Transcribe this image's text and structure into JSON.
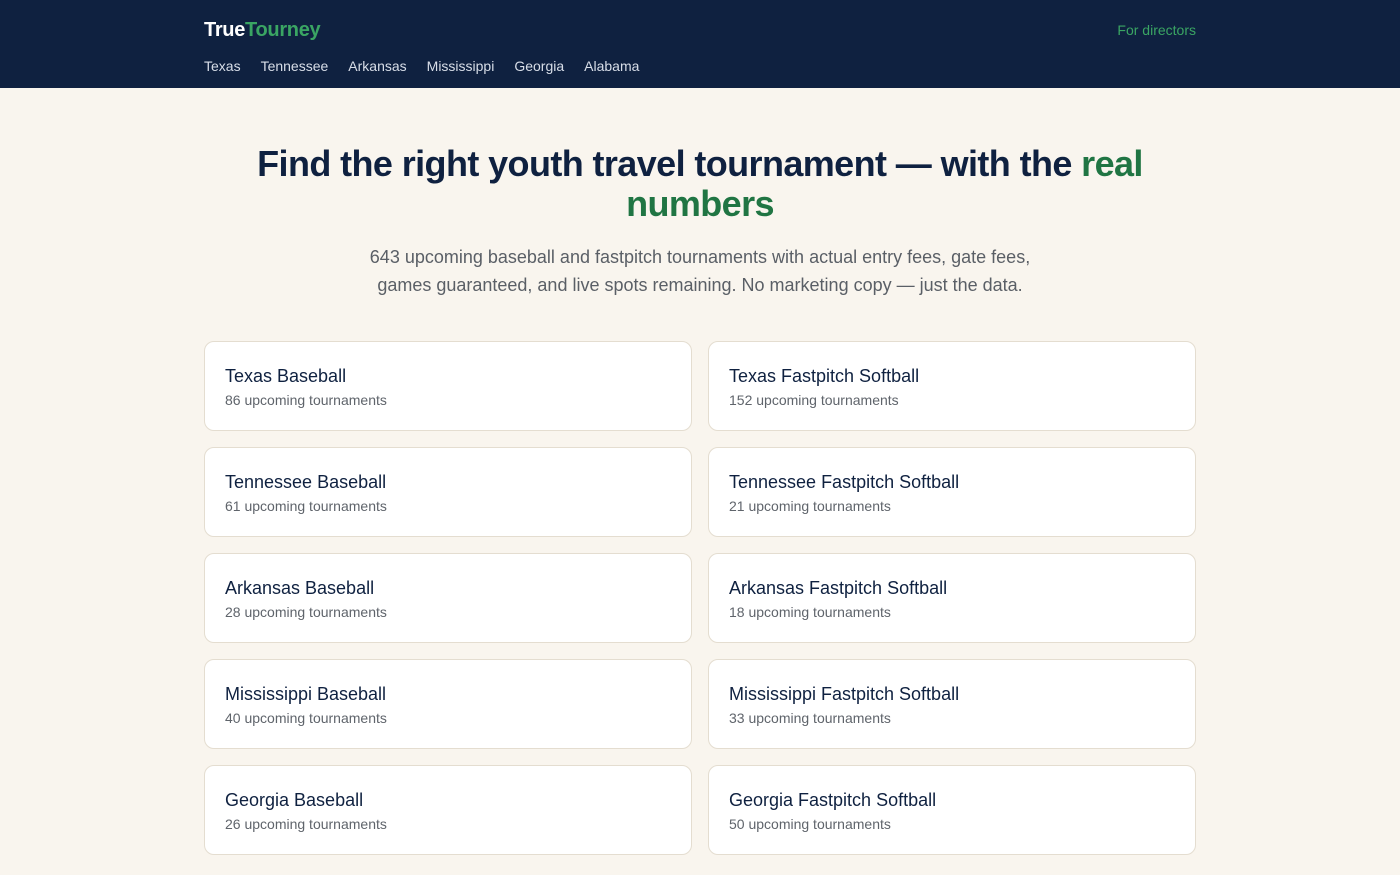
{
  "header": {
    "logo_part1": "True",
    "logo_part2": "Tourney",
    "directors_link": "For directors",
    "nav": [
      "Texas",
      "Tennessee",
      "Arkansas",
      "Mississippi",
      "Georgia",
      "Alabama"
    ]
  },
  "hero": {
    "title_main": "Find the right youth travel tournament — with the ",
    "title_accent": "real numbers",
    "subtitle": "643 upcoming baseball and fastpitch tournaments with actual entry fees, gate fees, games guaranteed, and live spots remaining. No marketing copy — just the data."
  },
  "cards": [
    {
      "title": "Texas Baseball",
      "count": "86 upcoming tournaments"
    },
    {
      "title": "Texas Fastpitch Softball",
      "count": "152 upcoming tournaments"
    },
    {
      "title": "Tennessee Baseball",
      "count": "61 upcoming tournaments"
    },
    {
      "title": "Tennessee Fastpitch Softball",
      "count": "21 upcoming tournaments"
    },
    {
      "title": "Arkansas Baseball",
      "count": "28 upcoming tournaments"
    },
    {
      "title": "Arkansas Fastpitch Softball",
      "count": "18 upcoming tournaments"
    },
    {
      "title": "Mississippi Baseball",
      "count": "40 upcoming tournaments"
    },
    {
      "title": "Mississippi Fastpitch Softball",
      "count": "33 upcoming tournaments"
    },
    {
      "title": "Georgia Baseball",
      "count": "26 upcoming tournaments"
    },
    {
      "title": "Georgia Fastpitch Softball",
      "count": "50 upcoming tournaments"
    }
  ],
  "colors": {
    "header_bg": "#0f2140",
    "accent_green": "#3aa563",
    "title_accent": "#207543",
    "page_bg": "#f9f5ee"
  }
}
